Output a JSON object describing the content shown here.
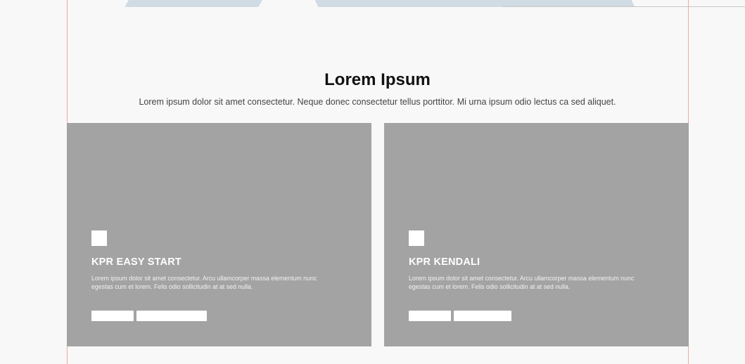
{
  "section": {
    "title": "Lorem Ipsum",
    "subtitle": "Lorem ipsum dolor sit amet consectetur. Neque donec consectetur tellus porttitor. Mi urna ipsum odio lectus ca sed aliquet."
  },
  "cards": [
    {
      "title": "KPR EASY START",
      "description": "Lorem ipsum dolor sit amet consectetur. Arcu ullamcorper massa elementum nunc egestas cum et lorem. Felis odio sollicitudin at at sed nulla.",
      "button_primary_label": "",
      "button_secondary_label": ""
    },
    {
      "title": "KPR KENDALI",
      "description": "Lorem ipsum dolor sit amet consectetur. Arcu ullamcorper massa elementum nunc egestas cum et lorem. Felis odio sollicitudin at at sed nulla.",
      "button_primary_label": "",
      "button_secondary_label": ""
    }
  ],
  "colors": {
    "background": "#f8f8f8",
    "card_background": "#a3a3a3",
    "guide_line": "#f1a9a0",
    "band": "#d0dbe4"
  }
}
